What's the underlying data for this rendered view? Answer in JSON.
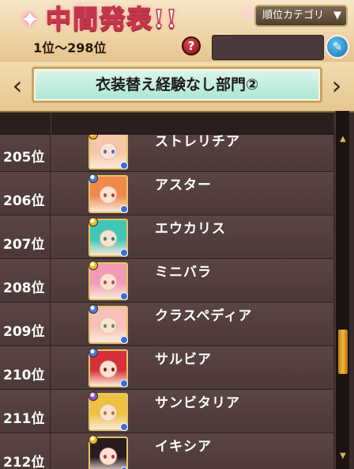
{
  "header": {
    "title": "中間発表!!",
    "rank_range": "1位～298位",
    "help_label": "?",
    "category_button_label": "順位カテゴリ",
    "category_button_arrow": "▼",
    "search_value": "",
    "edit_icon": "pencil-icon"
  },
  "banner": {
    "category_name": "衣装替え経験なし部門②",
    "prev_label": "‹",
    "next_label": "›"
  },
  "colors": {
    "title_outline": "#c4364b",
    "banner_bg": "#a9e6d4",
    "row_bg": "#4b3937",
    "scroll_thumb": "#f2b933"
  },
  "rows": [
    {
      "rank": "205位",
      "name": "ストレリチア",
      "rarity_color": "#f1b52a",
      "hair": "#f6c7a6",
      "eye": "#3b6fbf"
    },
    {
      "rank": "206位",
      "name": "アスター",
      "rarity_color": "#4a7be0",
      "hair": "#f08a4a",
      "eye": "#b14a2e"
    },
    {
      "rank": "207位",
      "name": "エウカリス",
      "rarity_color": "#f1b52a",
      "hair": "#3fc7b5",
      "eye": "#2a8a6a"
    },
    {
      "rank": "208位",
      "name": "ミニバラ",
      "rarity_color": "#f1b52a",
      "hair": "#f39ab5",
      "eye": "#c2406a"
    },
    {
      "rank": "209位",
      "name": "クラスペディア",
      "rarity_color": "#4a7be0",
      "hair": "#f7c0b8",
      "eye": "#4a9a5a"
    },
    {
      "rank": "210位",
      "name": "サルビア",
      "rarity_color": "#4a7be0",
      "hair": "#d63038",
      "eye": "#8a1a20"
    },
    {
      "rank": "211位",
      "name": "サンビタリア",
      "rarity_color": "#8a4fd8",
      "hair": "#f0c040",
      "eye": "#b07a20"
    },
    {
      "rank": "212位",
      "name": "イキシア",
      "rarity_color": "#f1b52a",
      "hair": "#2a1a20",
      "eye": "#c22a4a"
    }
  ]
}
